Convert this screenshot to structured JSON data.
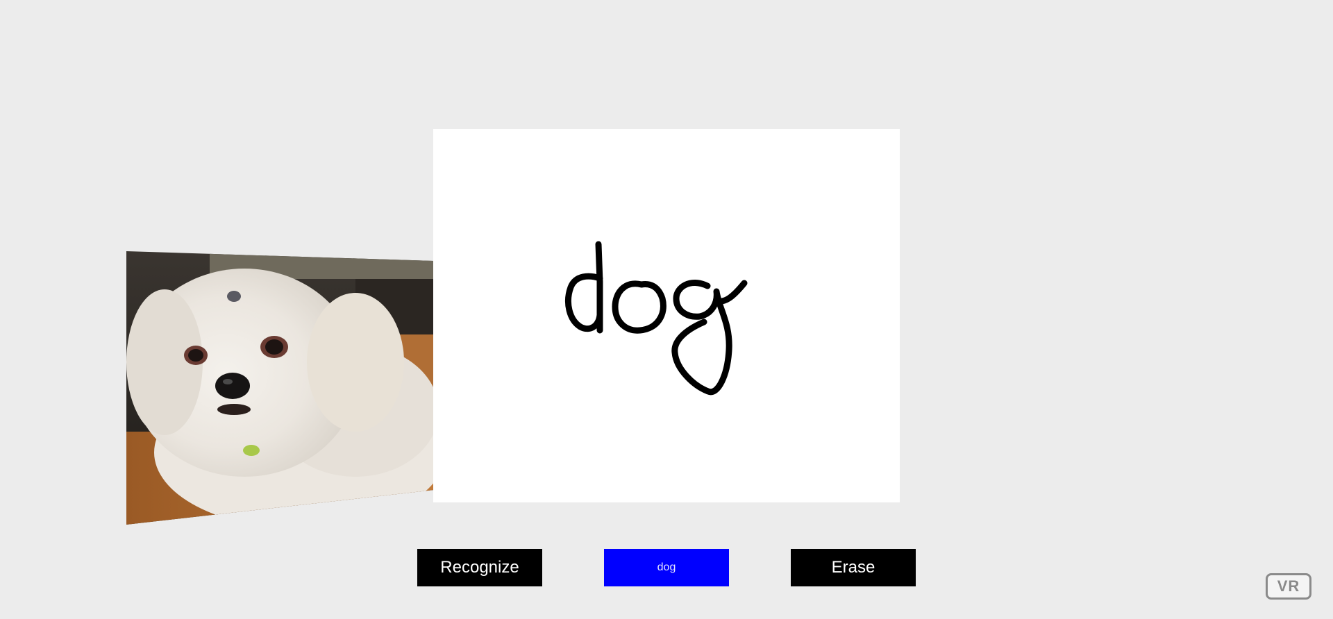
{
  "buttons": {
    "recognize_label": "Recognize",
    "result_label": "dog",
    "erase_label": "Erase"
  },
  "vr": {
    "label": "VR"
  },
  "colors": {
    "background": "#ececec",
    "canvas": "#ffffff",
    "ink": "#000000",
    "button": "#000000",
    "result_button": "#0000ff"
  },
  "icons": {
    "photo": "dog-photo",
    "vr": "vr-icon"
  }
}
